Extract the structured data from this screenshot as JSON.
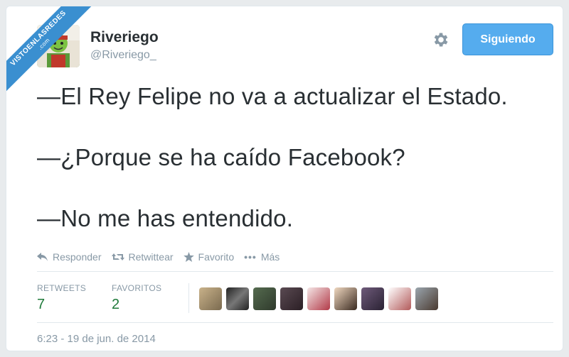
{
  "watermark": {
    "line1": "VISTOENLASREDES",
    "line2": ".com"
  },
  "user": {
    "display_name": "Riveriego",
    "handle": "@Riveriego_"
  },
  "follow_button": {
    "label": "Siguiendo"
  },
  "tweet": {
    "lines": [
      "—El Rey Felipe no va a actualizar el Estado.",
      "—¿Porque se ha caído Facebook?",
      "—No me has entendido."
    ]
  },
  "actions": {
    "reply": "Responder",
    "retweet": "Retwittear",
    "favorite": "Favorito",
    "more": "Más"
  },
  "stats": {
    "retweets_label": "RETWEETS",
    "retweets_value": "7",
    "favorites_label": "FAVORITOS",
    "favorites_value": "2"
  },
  "timestamp": "6:23 - 19 de jun. de 2014",
  "colors": {
    "follow_button": "#55acee",
    "stat_value": "#1f7a3a",
    "muted": "#8899a6",
    "text": "#292f33",
    "watermark": "#3a8fd0"
  }
}
